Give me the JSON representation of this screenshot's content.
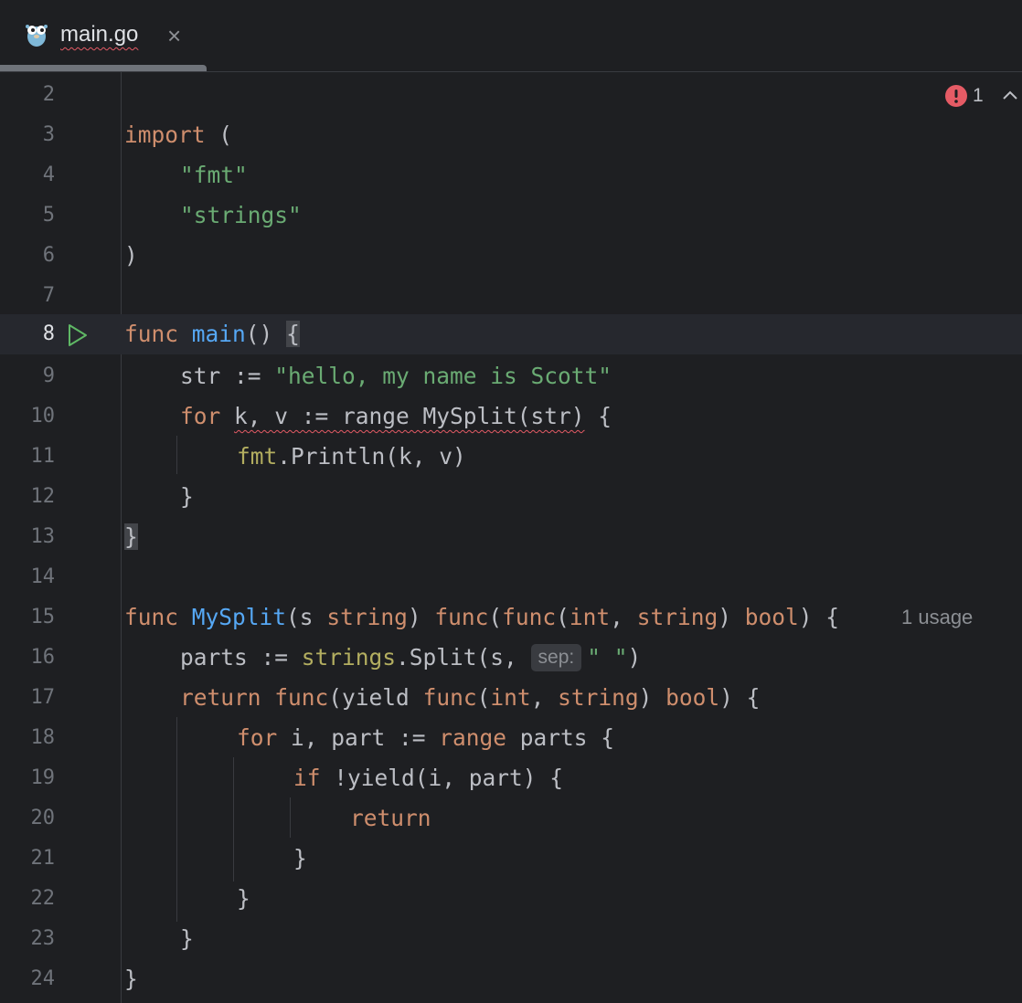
{
  "tab": {
    "name": "main.go",
    "close": "×"
  },
  "problems": {
    "count": "1"
  },
  "lines": [
    {
      "num": "2"
    },
    {
      "num": "3"
    },
    {
      "num": "4"
    },
    {
      "num": "5"
    },
    {
      "num": "6"
    },
    {
      "num": "7"
    },
    {
      "num": "8"
    },
    {
      "num": "9"
    },
    {
      "num": "10"
    },
    {
      "num": "11"
    },
    {
      "num": "12"
    },
    {
      "num": "13"
    },
    {
      "num": "14"
    },
    {
      "num": "15"
    },
    {
      "num": "16"
    },
    {
      "num": "17"
    },
    {
      "num": "18"
    },
    {
      "num": "19"
    },
    {
      "num": "20"
    },
    {
      "num": "21"
    },
    {
      "num": "22"
    },
    {
      "num": "23"
    },
    {
      "num": "24"
    }
  ],
  "code": {
    "l3": {
      "kw": "import",
      "rest": " ("
    },
    "l4": "\"fmt\"",
    "l5": "\"strings\"",
    "l6": ")",
    "l8": {
      "kw": "func",
      "name": "main",
      "rest": "() ",
      "brace": "{"
    },
    "l9": {
      "pre": "str := ",
      "str": "\"hello, my name is Scott\""
    },
    "l10": {
      "kw": "for",
      "err": "k, v := range MySplit(str)",
      "rest": " {"
    },
    "l11": {
      "pkg": "fmt",
      "rest": ".Println(k, v)"
    },
    "l12": "}",
    "l13": "}",
    "l15": {
      "kw": "func",
      "name": "MySplit",
      "rest": "(s string) func(func(int, string) bool) {"
    },
    "l16": {
      "pre": "parts := ",
      "pkg": "strings",
      "call": ".Split(s, ",
      "hint": "sep:",
      "str": "\" \"",
      "post": ")"
    },
    "l17": {
      "kw": "return",
      "rest": " func(yield func(int, string) bool) {"
    },
    "l18": {
      "kw": "for",
      "rest1": " i, part := ",
      "kw2": "range",
      "rest2": " parts {"
    },
    "l19": {
      "kw": "if",
      "rest": " !yield(i, part) {"
    },
    "l20": "return",
    "l21": "}",
    "l22": "}",
    "l23": "}",
    "l24": "}"
  },
  "usage_hint": "1 usage",
  "colors": {
    "background": "#1e1f22",
    "keyword": "#cf8e6d",
    "string": "#6aab73",
    "function": "#56a8f5",
    "error": "#e55b65",
    "run": "#5fb865"
  }
}
